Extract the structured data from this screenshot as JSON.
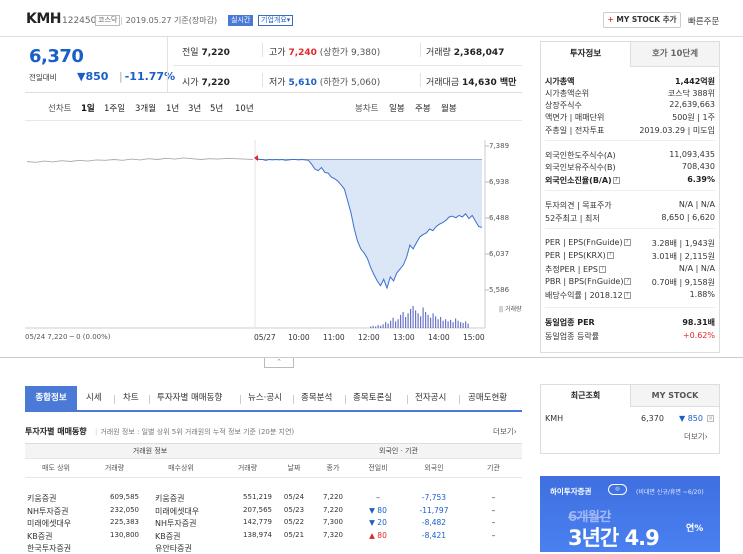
{
  "header": {
    "name": "KMH",
    "code": "122450",
    "market_tag": "코스닥",
    "date_text": "2019.05.27 기준(장마감)",
    "realtime_tag": "실시간",
    "company_tag": "기업개요",
    "mystock_label": "MY STOCK 추가",
    "quick_order": "빠른주문"
  },
  "quote": {
    "price": "6,370",
    "change_label": "전일대비",
    "change": "850",
    "change_pct": "-11.77%",
    "prev_close_label": "전일",
    "prev_close": "7,220",
    "high_label": "고가",
    "high": "7,240",
    "upper_limit": "(상한가 9,380)",
    "volume_label": "거래량",
    "volume": "2,368,047",
    "open_label": "시가",
    "open": "7,220",
    "low_label": "저가",
    "low": "5,610",
    "lower_limit": "(하한가 5,060)",
    "amount_label": "거래대금",
    "amount": "14,630 백만"
  },
  "period_bar": {
    "left_label": "선차트",
    "periods": [
      "1일",
      "1주일",
      "3개월",
      "1년",
      "3년",
      "5년",
      "10년"
    ],
    "right_label": "봉차트",
    "candles": [
      "일봉",
      "주봉",
      "월봉"
    ]
  },
  "chart_data": {
    "type": "line",
    "title": "",
    "xlabel": "",
    "ylabel": "",
    "x_ticks": [
      "05/27",
      "10:00",
      "11:00",
      "12:00",
      "13:00",
      "14:00",
      "15:00"
    ],
    "y_ticks": [
      "7,389",
      "6,938",
      "6,488",
      "6,037",
      "5,586"
    ],
    "ylim": [
      5586,
      7389
    ],
    "prev_close": 7220,
    "volume_label": "|| 거래량",
    "left_caption": "05/24  7,220 ─ 0 (0.00%)",
    "series": [
      {
        "values": [
          7195,
          7185,
          7200,
          7190,
          7205,
          7195,
          7210,
          7200,
          7215,
          7210,
          7220,
          7210,
          7225,
          7215,
          7230,
          7220,
          7235,
          7225,
          7240,
          7230,
          7220,
          7230,
          7225,
          7235,
          7230,
          7225,
          7220
        ]
      },
      {
        "values": [
          7240,
          7220,
          7220,
          7210,
          7220,
          7215,
          7220,
          7215,
          7220,
          7210,
          7215,
          7220,
          7220,
          7215,
          7220,
          7215,
          7210,
          7160,
          7100,
          7080,
          7120,
          7060,
          7050,
          7000,
          6980,
          6950,
          6900,
          6850,
          6700,
          6550,
          6350,
          6200,
          6100,
          6050,
          5980,
          5870,
          5780,
          5700,
          5640,
          5720,
          5610,
          5750,
          5700,
          5800,
          5850,
          5900,
          6000,
          6150,
          6100,
          6180,
          6250,
          6280,
          6300,
          6350,
          6330,
          6380,
          6410,
          6430,
          6460,
          6500,
          6510,
          6490,
          6520,
          6500,
          6540,
          6480,
          6520,
          6450,
          6380,
          6370
        ]
      }
    ],
    "volume": [
      2,
      3,
      2,
      4,
      3,
      5,
      8,
      6,
      10,
      14,
      9,
      12,
      18,
      22,
      15,
      20,
      26,
      30,
      24,
      20,
      16,
      28,
      22,
      18,
      14,
      20,
      16,
      12,
      15,
      10,
      12,
      9,
      11,
      8,
      13,
      10,
      8,
      7,
      9,
      6
    ]
  },
  "side_panel": {
    "tabs": [
      "투자정보",
      "호가 10단계"
    ],
    "rows": [
      {
        "k": "시가총액",
        "v": "1,442억원",
        "bold": true
      },
      {
        "k": "시가총액순위",
        "v": "코스닥 388위"
      },
      {
        "k": "상장주식수",
        "v": "22,639,663"
      },
      {
        "k": "액면가 | 매매단위",
        "v": "500원 | 1주"
      },
      {
        "k": "주총일 | 전자투표",
        "v": "2019.03.29 | 미도입"
      },
      {
        "k": "외국인한도주식수(A)",
        "v": "11,093,435"
      },
      {
        "k": "외국인보유주식수(B)",
        "v": "708,430"
      },
      {
        "k": "외국인소진율(B/A)",
        "v": "6.39%",
        "bold": true
      },
      {
        "k": "투자의견 | 목표주가",
        "v": "N/A | N/A"
      },
      {
        "k": "52주최고 | 최저",
        "v": "8,650 | 6,620"
      },
      {
        "k": "PER | EPS(FnGuide)",
        "v": "3.28배 | 1,943원"
      },
      {
        "k": "PER | EPS(KRX)",
        "v": "3.01배 | 2,115원"
      },
      {
        "k": "추정PER | EPS",
        "v": "N/A | N/A"
      },
      {
        "k": "PBR | BPS(FnGuide)",
        "v": "0.70배 | 9,158원"
      },
      {
        "k": "배당수익률 | 2018.12",
        "v": "1.88%"
      },
      {
        "k": "동일업종 PER",
        "v": "98.31배",
        "bold": true
      },
      {
        "k": "동일업종 등락률",
        "v": "+0.62%"
      }
    ]
  },
  "tabs": [
    "종합정보",
    "시세",
    "차트",
    "투자자별 매매동향",
    "뉴스·공시",
    "종목분석",
    "종목토론실",
    "전자공시",
    "공매도현황"
  ],
  "investor": {
    "title": "투자자별 매매동향",
    "desc": "거래원 정보 : 일별 상위 5위 거래원의 누적 정보 기준 (20분 지연)",
    "more": "더보기",
    "group_left": "거래원 정보",
    "group_right": "외국인 · 기관",
    "cols": [
      "매도 상위",
      "거래량",
      "매수상위",
      "거래량",
      "날짜",
      "종가",
      "전일비",
      "외국인",
      "기관"
    ],
    "rows": [
      {
        "sell": "키움증권",
        "sv": "609,585",
        "buy": "키움증권",
        "bv": "551,219",
        "date": "05/24",
        "close": "7,220",
        "diff": "–",
        "dir": "none",
        "foreign": "-7,753",
        "inst": "–"
      },
      {
        "sell": "NH투자증권",
        "sv": "232,050",
        "buy": "미래에셋대우",
        "bv": "207,565",
        "date": "05/23",
        "close": "7,220",
        "diff": "80",
        "dir": "down",
        "foreign": "-11,797",
        "inst": "–"
      },
      {
        "sell": "미래에셋대우",
        "sv": "225,383",
        "buy": "NH투자증권",
        "bv": "142,779",
        "date": "05/22",
        "close": "7,300",
        "diff": "20",
        "dir": "down",
        "foreign": "-8,482",
        "inst": "–"
      },
      {
        "sell": "KB증권",
        "sv": "130,800",
        "buy": "KB증권",
        "bv": "138,974",
        "date": "05/21",
        "close": "7,320",
        "diff": "80",
        "dir": "up",
        "foreign": "-8,421",
        "inst": "–"
      },
      {
        "sell": "한국투자증권",
        "sv": "",
        "buy": "유안타증권",
        "bv": "",
        "date": "",
        "close": "",
        "diff": "",
        "dir": "none",
        "foreign": "",
        "inst": ""
      }
    ]
  },
  "recent": {
    "tabs": [
      "최근조회",
      "MY STOCK"
    ],
    "name": "KMH",
    "price": "6,370",
    "change": "850",
    "more": "더보기"
  },
  "banner": {
    "brand": "하이투자증권",
    "note": "(비대면 신규/휴면 ~6/20)",
    "line1": "6개월간",
    "line2": "3년간 4.9",
    "suffix": "연%"
  },
  "colors": {
    "up": "#e0282a",
    "down": "#1a5ec8",
    "accent": "#4a79d6"
  }
}
